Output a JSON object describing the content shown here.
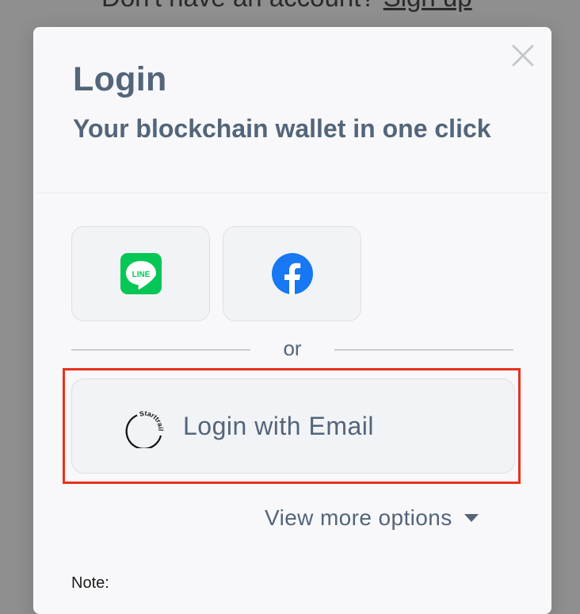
{
  "background": {
    "prompt_text": "Don't have an account?",
    "signup_link": "Sign up"
  },
  "modal": {
    "title": "Login",
    "subtitle": "Your blockchain wallet in one click",
    "close_icon": "close-icon",
    "social": [
      {
        "name": "LINE",
        "icon": "line-icon",
        "icon_text": "LINE",
        "color": "#06C755"
      },
      {
        "name": "Facebook",
        "icon": "facebook-icon",
        "color": "#1877F2"
      }
    ],
    "separator": "or",
    "email_button": {
      "label": "Login with Email",
      "logo_icon": "starttrail-logo-icon",
      "logo_text": "Starttrail"
    },
    "view_more": "View more options",
    "note_label": "Note:"
  },
  "colors": {
    "text_primary": "#536579",
    "highlight_border": "#E8321C",
    "modal_bg": "#F8F8FB",
    "overlay": "#8F8F8F"
  }
}
